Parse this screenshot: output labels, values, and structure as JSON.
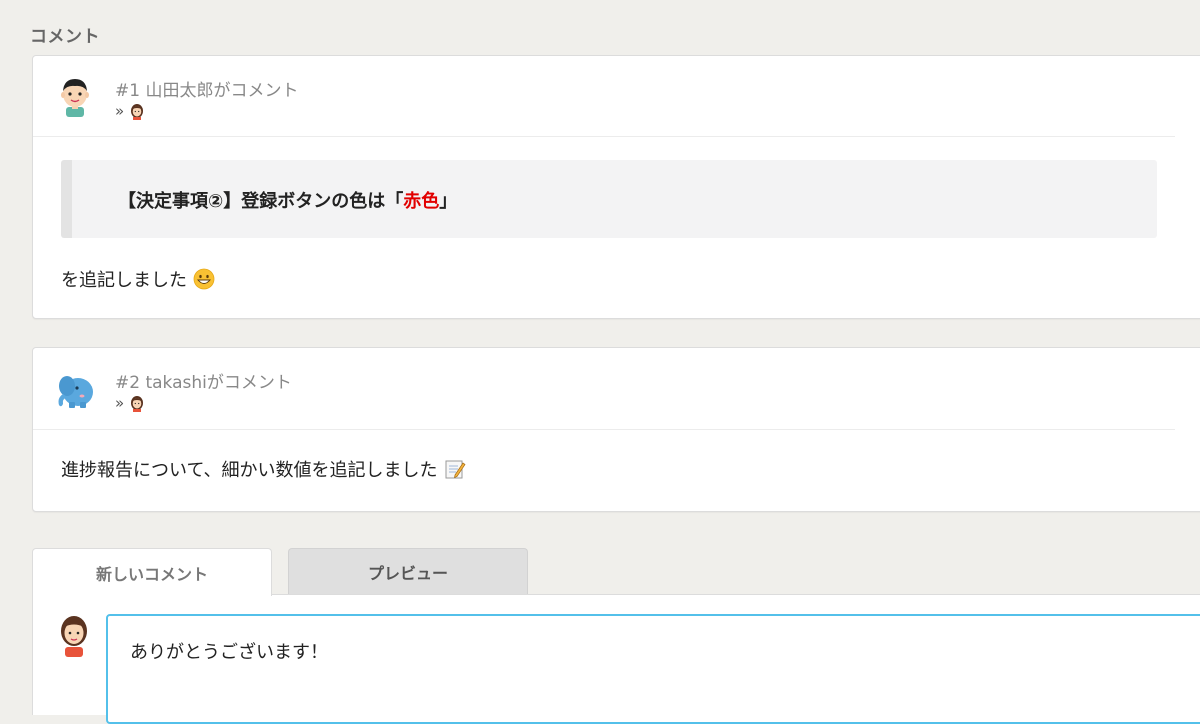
{
  "section_title": "コメント",
  "comments": [
    {
      "number_author": "#1 山田太郎がコメント",
      "notify_prefix": "»",
      "avatar": "boy-avatar-icon",
      "quote_prefix": "【決定事項②】登録ボタンの色は「",
      "quote_highlight": "赤色",
      "quote_suffix": "」",
      "highlight_color": "#e20000",
      "body": "を追記しました",
      "emoji": "grinning-face-emoji"
    },
    {
      "number_author": "#2 takashiがコメント",
      "notify_prefix": "»",
      "avatar": "elephant-avatar-icon",
      "body": "進捗報告について、細かい数値を追記しました",
      "emoji": "memo-emoji"
    }
  ],
  "tabs": {
    "new_comment": "新しいコメント",
    "preview": "プレビュー"
  },
  "editor": {
    "value": "ありがとうございます！",
    "focus_color": "#53c0ea"
  }
}
